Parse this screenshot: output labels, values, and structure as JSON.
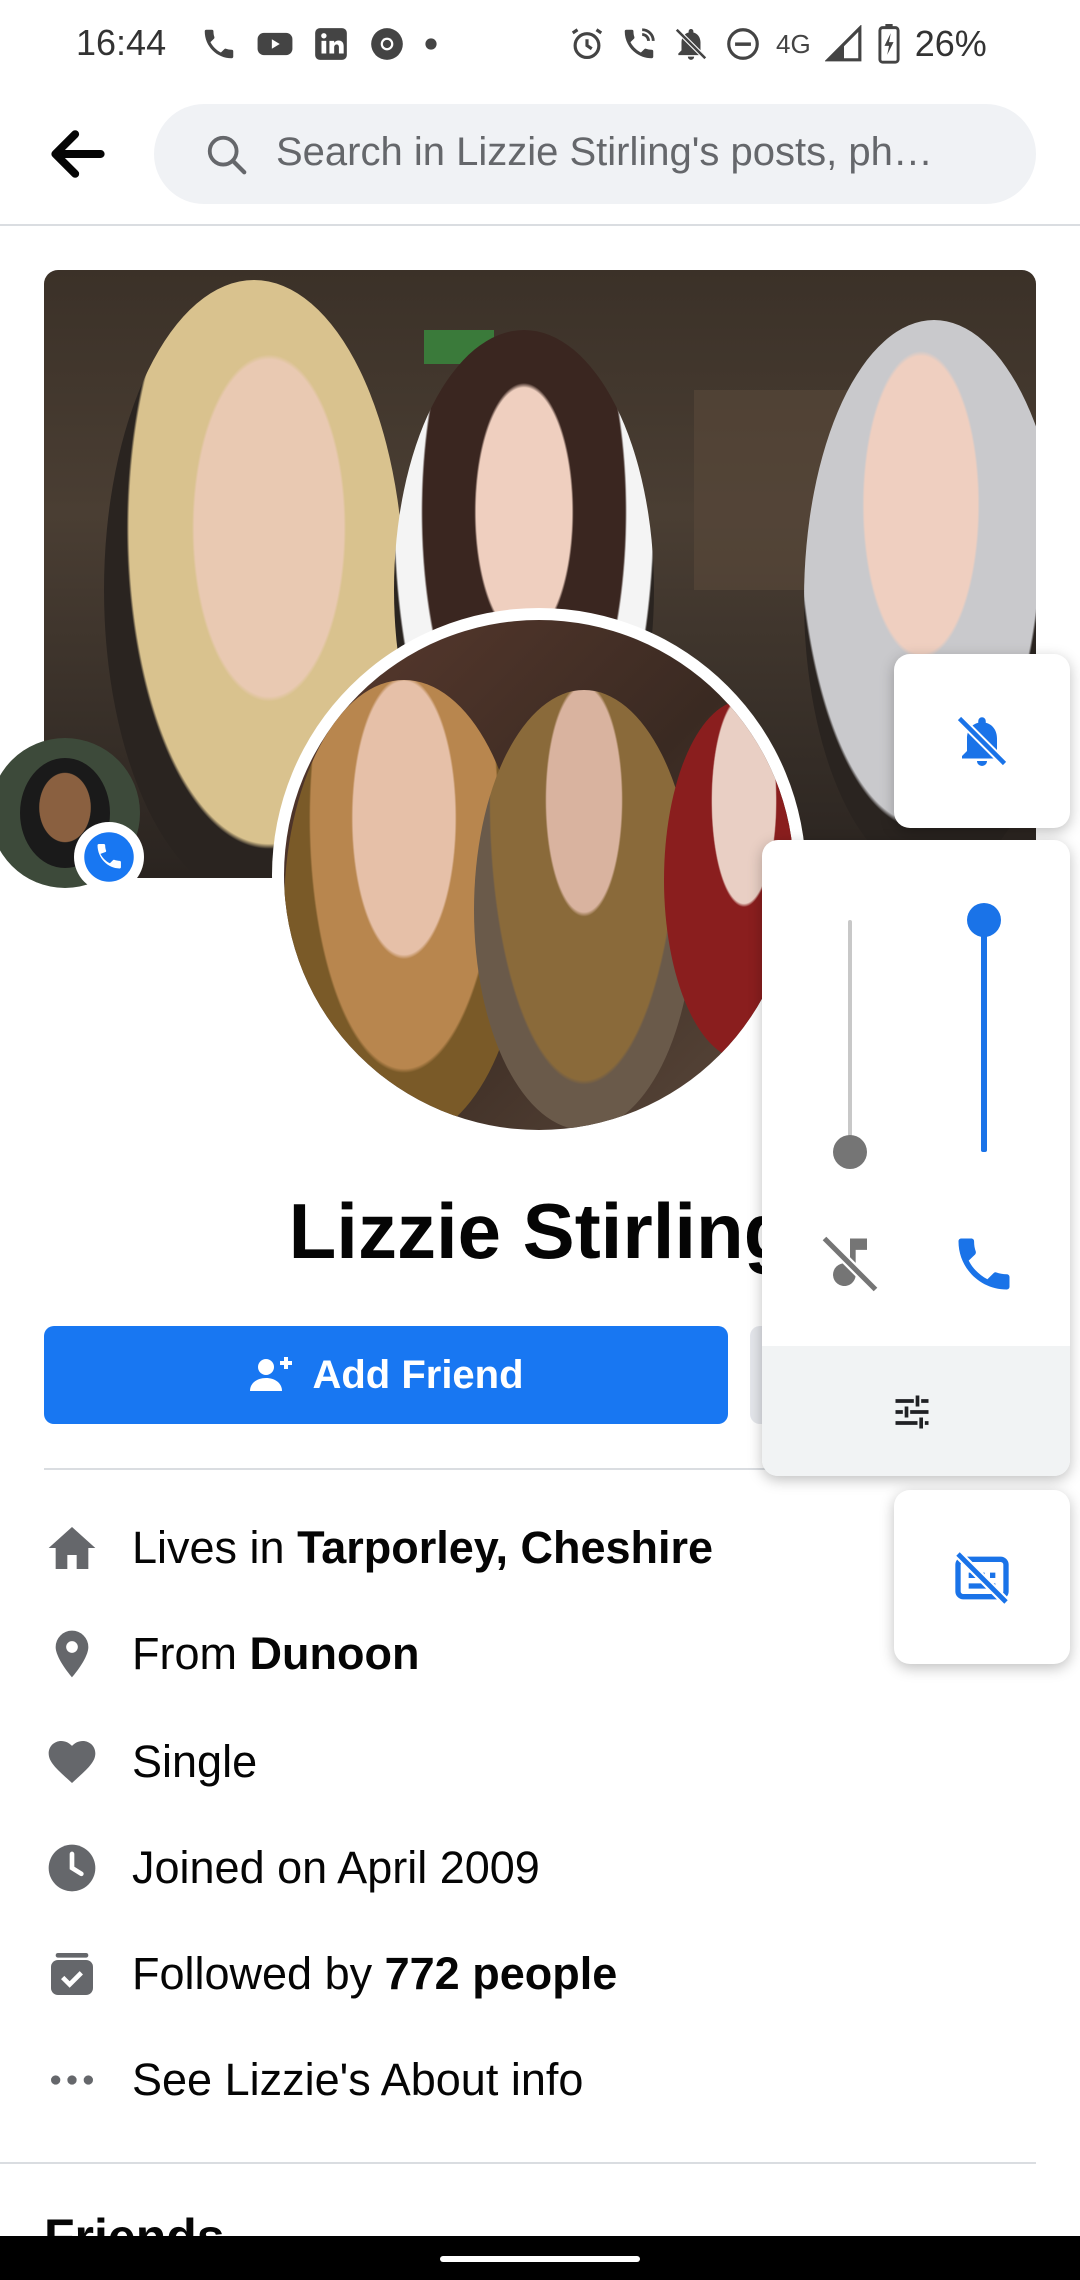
{
  "status_bar": {
    "time": "16:44",
    "network": "4G",
    "battery": "26%"
  },
  "header": {
    "search_placeholder": "Search in Lizzie Stirling's posts, ph…"
  },
  "profile": {
    "name": "Lizzie Stirling",
    "add_friend_label": "Add Friend"
  },
  "details": {
    "lives_prefix": "Lives in ",
    "lives_place": "Tarporley, Cheshire",
    "from_prefix": "From ",
    "from_place": "Dunoon",
    "relationship": "Single",
    "joined": "Joined on April 2009",
    "followed_prefix": "Followed by ",
    "followed_count": "772 people",
    "about": "See Lizzie's About info"
  },
  "friends_heading": "Friends",
  "volume_panel": {
    "ring_level": 0,
    "call_level": 1
  },
  "colors": {
    "brand_blue": "#1877f2",
    "android_blue": "#1a73e8",
    "icon_gray": "#65676b"
  }
}
